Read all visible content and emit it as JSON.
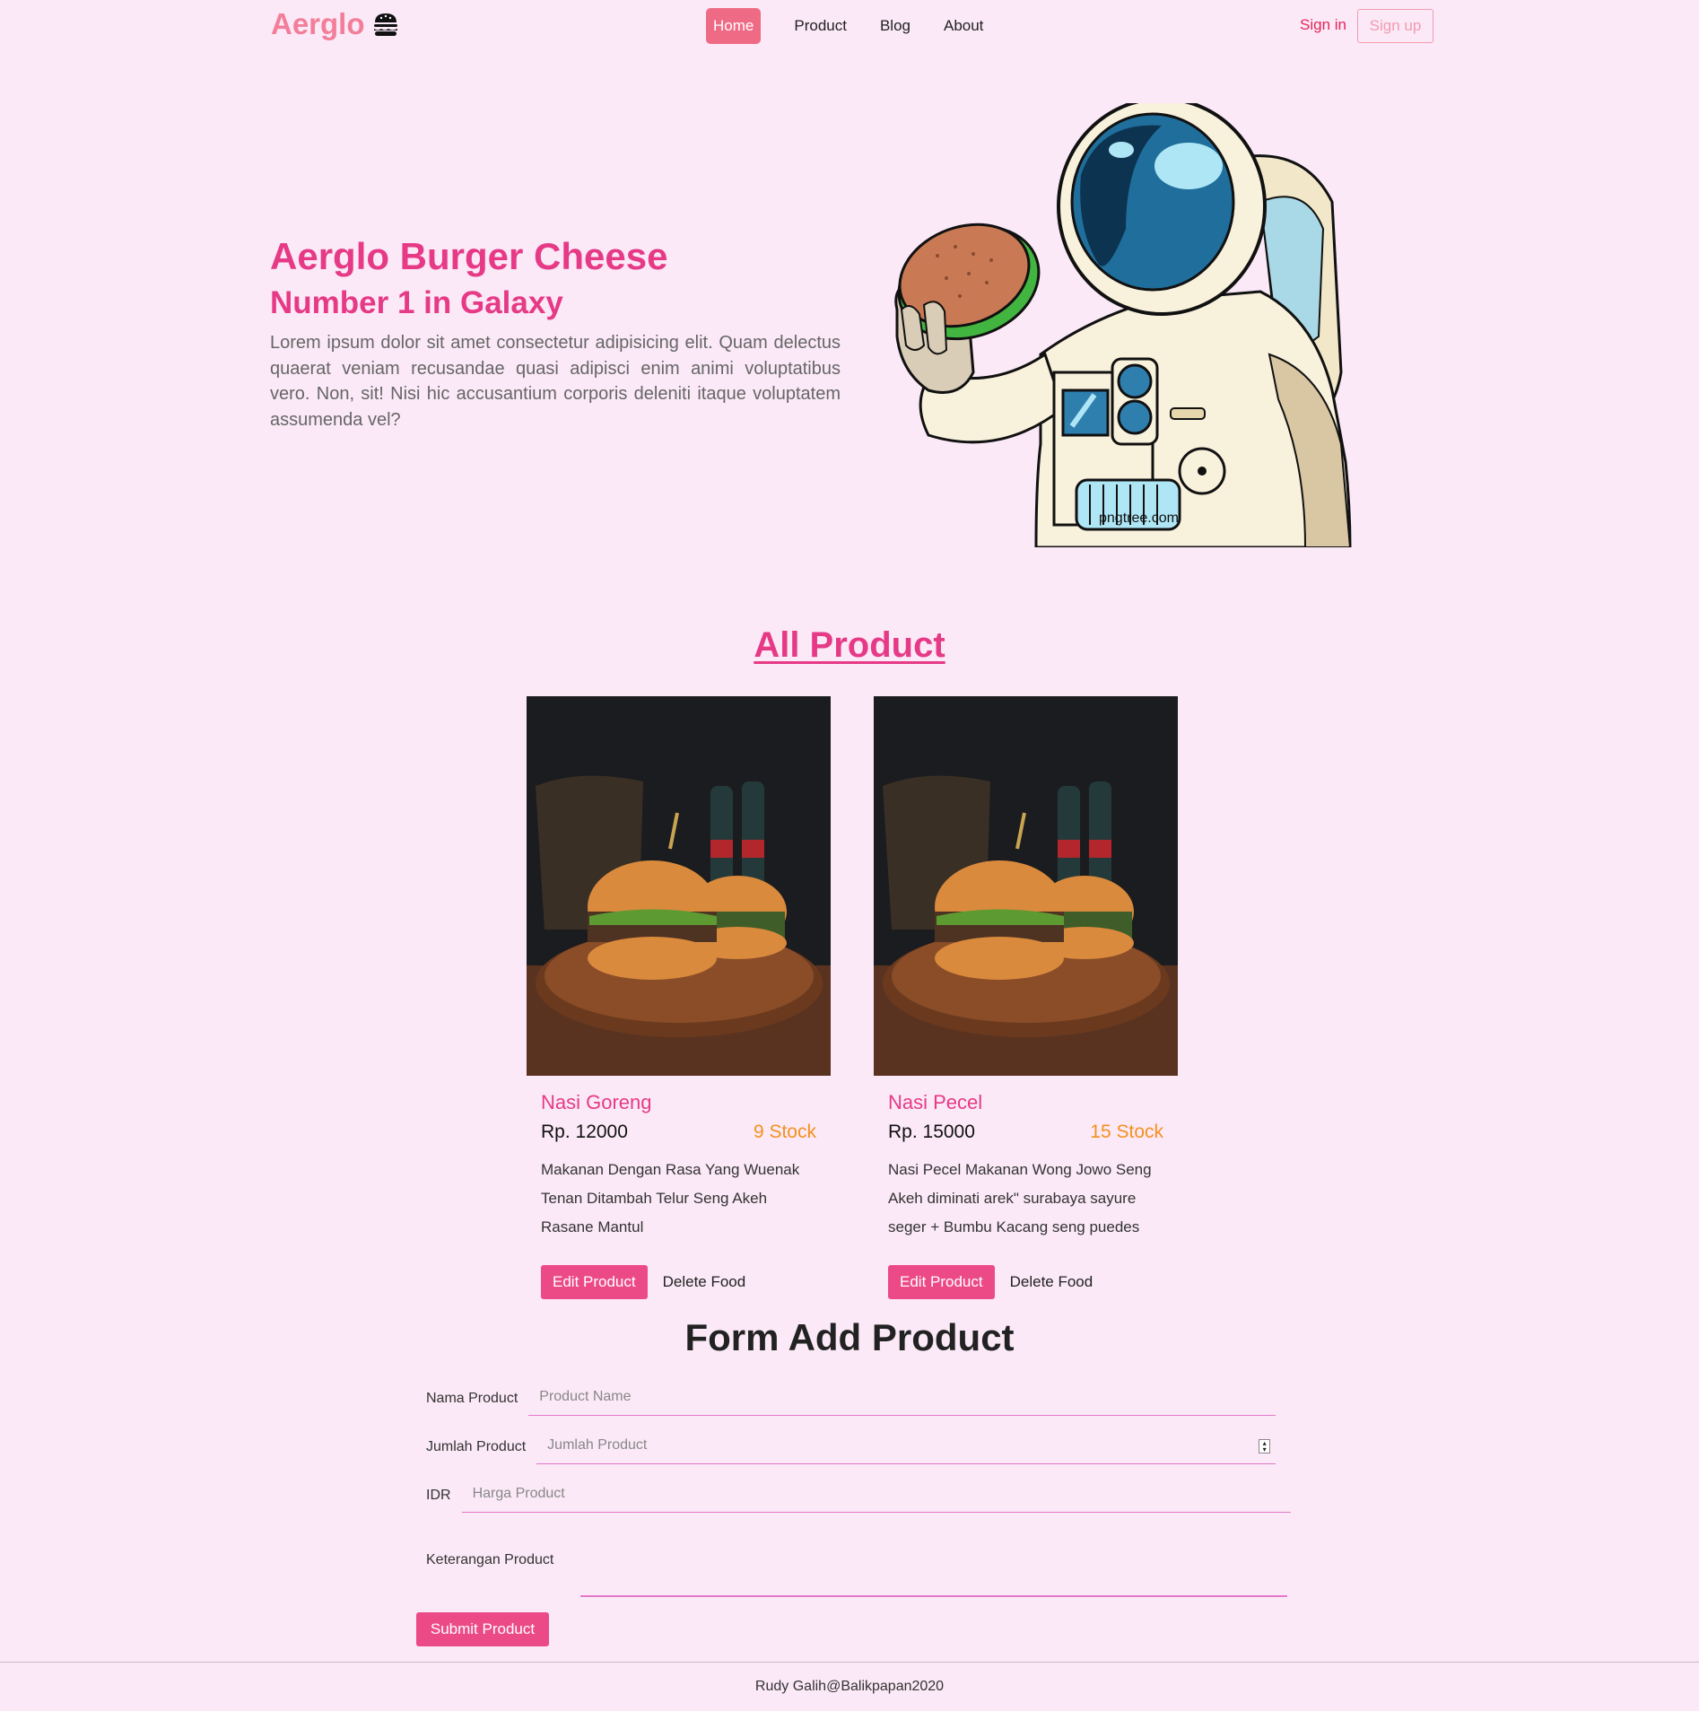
{
  "navbar": {
    "brand": "Aerglo",
    "brand_icon": "burger-icon",
    "links": [
      "Home",
      "Product",
      "Blog",
      "About"
    ],
    "active_link": "Home",
    "signin": "Sign in",
    "signup": "Sign up"
  },
  "hero": {
    "title": "Aerglo Burger Cheese",
    "subtitle": "Number 1 in Galaxy",
    "text": "Lorem ipsum dolor sit amet consectetur adipisicing elit. Quam delectus quaerat veniam recusandae quasi adipisci enim animi voluptatibus vero. Non, sit! Nisi hic accusantium corporis deleniti itaque voluptatem assumenda vel?",
    "image_watermark": "pngtree.com"
  },
  "products": {
    "title": "All Product",
    "items": [
      {
        "name": "Nasi Goreng",
        "price": "Rp. 12000",
        "stock": "9 Stock",
        "description": "Makanan Dengan Rasa Yang Wuenak Tenan Ditambah Telur Seng Akeh Rasane Mantul",
        "edit_label": "Edit Product",
        "delete_label": "Delete Food"
      },
      {
        "name": "Nasi Pecel",
        "price": "Rp. 15000",
        "stock": "15 Stock",
        "description": "Nasi Pecel Makanan Wong Jowo Seng Akeh diminati arek\" surabaya sayure seger + Bumbu Kacang seng puedes",
        "edit_label": "Edit Product",
        "delete_label": "Delete Food"
      }
    ]
  },
  "form": {
    "title": "Form Add Product",
    "name_label": "Nama Product",
    "name_placeholder": "Product Name",
    "qty_label": "Jumlah Product",
    "qty_placeholder": "Jumlah Product",
    "price_label": "IDR",
    "price_placeholder": "Harga Product",
    "desc_label": "Keterangan Product",
    "submit_label": "Submit Product"
  },
  "footer": {
    "text": "Rudy Galih@Balikpapan2020"
  },
  "colors": {
    "background": "#fbe9f7",
    "brand": "#f27e9a",
    "accent": "#e63a86",
    "button": "#ec4a86",
    "stock": "#f5901e"
  }
}
